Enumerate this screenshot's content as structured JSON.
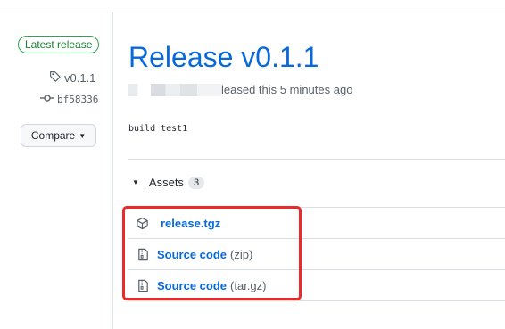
{
  "sidebar": {
    "latest_badge": "Latest release",
    "tag": "v0.1.1",
    "commit": "bf58336",
    "compare_label": "Compare"
  },
  "release": {
    "title": "Release v0.1.1",
    "released_text": "leased this 5 minutes ago",
    "body": "build test1"
  },
  "assets": {
    "label": "Assets",
    "count": "3",
    "items": [
      {
        "name": "release.tgz",
        "suffix": "",
        "icon": "package-icon"
      },
      {
        "name": "Source code",
        "suffix": "(zip)",
        "icon": "file-zip-icon"
      },
      {
        "name": "Source code",
        "suffix": "(tar.gz)",
        "icon": "file-zip-icon"
      }
    ]
  },
  "colors": {
    "accent": "#0969da",
    "badge_green": "#1a7f37",
    "highlight": "#ea2b2b"
  }
}
